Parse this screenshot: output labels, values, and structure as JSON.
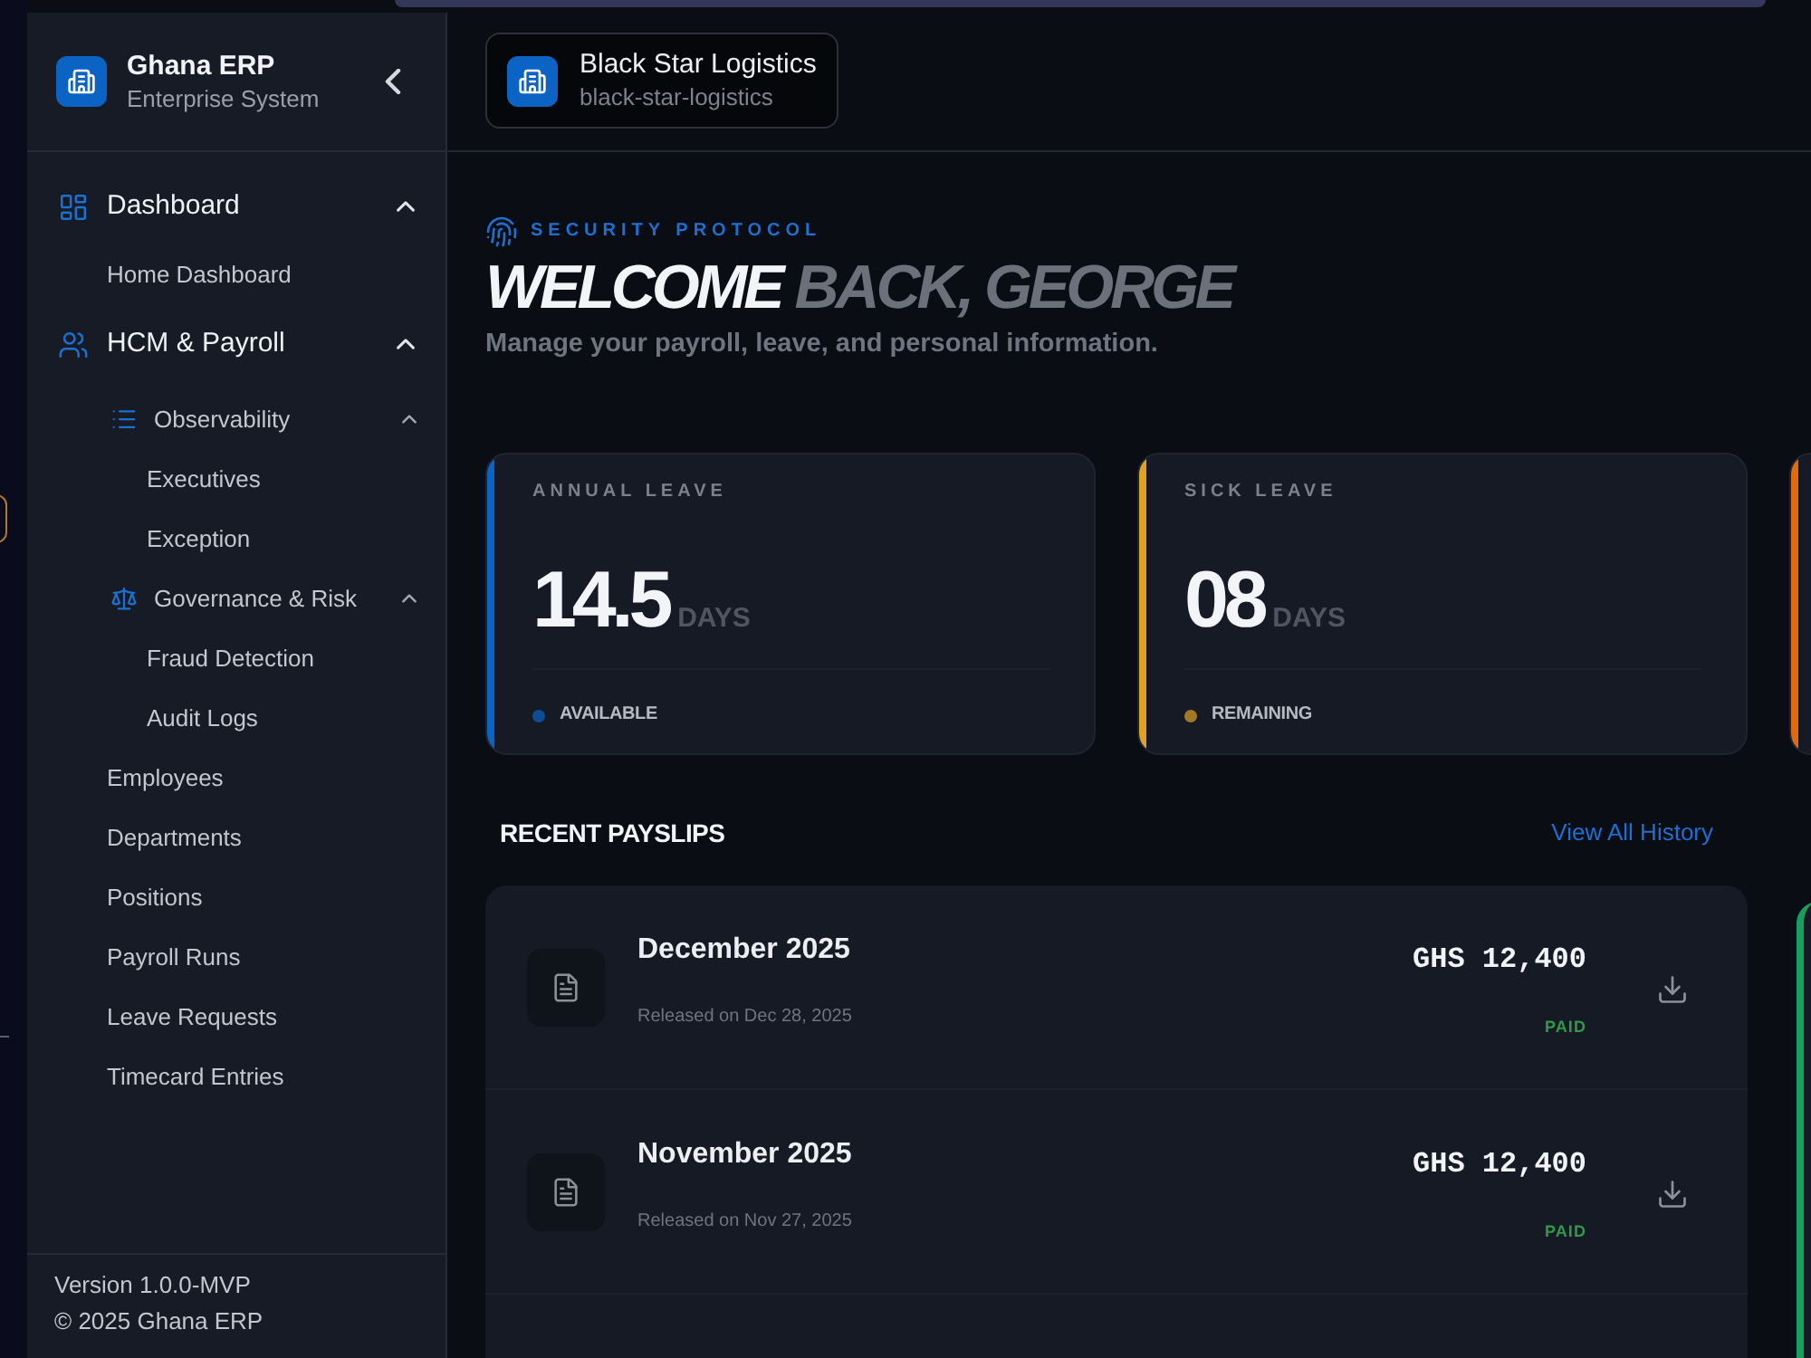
{
  "sidebar": {
    "brand": {
      "name": "Ghana ERP",
      "subtitle": "Enterprise System"
    },
    "sections": [
      {
        "label": "Dashboard",
        "expanded": true,
        "children": [
          {
            "kind": "link",
            "label": "Home Dashboard"
          }
        ]
      },
      {
        "label": "HCM & Payroll",
        "expanded": true,
        "children": [
          {
            "kind": "group",
            "label": "Observability",
            "expanded": true,
            "children": [
              {
                "kind": "link",
                "label": "Executives"
              },
              {
                "kind": "link",
                "label": "Exception"
              }
            ]
          },
          {
            "kind": "group",
            "label": "Governance & Risk",
            "expanded": true,
            "children": [
              {
                "kind": "link",
                "label": "Fraud Detection"
              },
              {
                "kind": "link",
                "label": "Audit Logs"
              }
            ]
          },
          {
            "kind": "link",
            "label": "Employees"
          },
          {
            "kind": "link",
            "label": "Departments"
          },
          {
            "kind": "link",
            "label": "Positions"
          },
          {
            "kind": "link",
            "label": "Payroll Runs"
          },
          {
            "kind": "link",
            "label": "Leave Requests"
          },
          {
            "kind": "link",
            "label": "Timecard Entries"
          }
        ]
      }
    ],
    "footer": {
      "version": "Version 1.0.0-MVP",
      "copyright": "© 2025 Ghana ERP"
    }
  },
  "header": {
    "company": {
      "name": "Black Star Logistics",
      "slug": "black-star-logistics"
    }
  },
  "welcome": {
    "eyebrow": "SECURITY PROTOCOL",
    "title": {
      "lead": "WELCOME",
      "rest": "BACK, GEORGE"
    },
    "subtitle": "Manage your payroll, leave, and personal information."
  },
  "leave_cards": [
    {
      "label": "ANNUAL LEAVE",
      "value": "14.5",
      "unit": "DAYS",
      "status": "AVAILABLE",
      "color": "#0b63c4"
    },
    {
      "label": "SICK LEAVE",
      "value": "08",
      "unit": "DAYS",
      "status": "REMAINING",
      "color": "#dfa225"
    },
    {
      "color": "#e06b0d"
    }
  ],
  "payslips": {
    "title": "RECENT PAYSLIPS",
    "link": "View All History",
    "rows": [
      {
        "month": "December 2025",
        "released": "Released on Dec 28, 2025",
        "amount": "GHS 12,400",
        "status": "PAID"
      },
      {
        "month": "November 2025",
        "released": "Released on Nov 27, 2025",
        "amount": "GHS 12,400",
        "status": "PAID"
      }
    ]
  }
}
